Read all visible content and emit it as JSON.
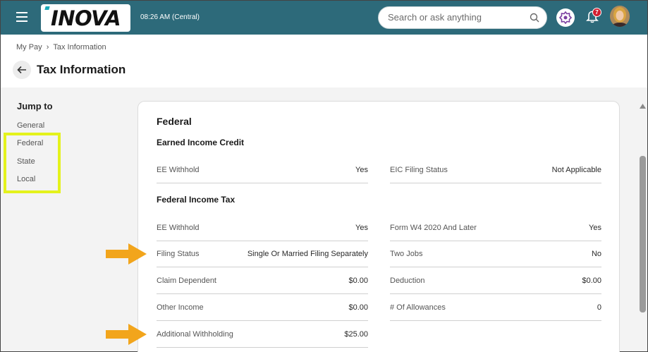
{
  "header": {
    "time": "08:26 AM (Central)",
    "logo_text": "INOVA",
    "search_placeholder": "Search or ask anything",
    "notification_count": "7",
    "brand_color": "#2d6a7a"
  },
  "breadcrumb": {
    "parent": "My Pay",
    "current": "Tax Information"
  },
  "page_title": "Tax Information",
  "jump_to": {
    "title": "Jump to",
    "items": [
      "General",
      "Federal",
      "State",
      "Local"
    ]
  },
  "federal": {
    "title": "Federal",
    "eic": {
      "title": "Earned Income Credit",
      "left": [
        {
          "label": "EE Withhold",
          "value": "Yes"
        }
      ],
      "right": [
        {
          "label": "EIC Filing Status",
          "value": "Not Applicable"
        }
      ]
    },
    "fit": {
      "title": "Federal Income Tax",
      "left": [
        {
          "label": "EE Withhold",
          "value": "Yes"
        },
        {
          "label": "Filing Status",
          "value": "Single Or Married Filing Separately"
        },
        {
          "label": "Claim Dependent",
          "value": "$0.00"
        },
        {
          "label": "Other Income",
          "value": "$0.00"
        },
        {
          "label": "Additional Withholding",
          "value": "$25.00"
        }
      ],
      "right": [
        {
          "label": "Form W4 2020 And Later",
          "value": "Yes"
        },
        {
          "label": "Two Jobs",
          "value": "No"
        },
        {
          "label": "Deduction",
          "value": "$0.00"
        },
        {
          "label": "# Of Allowances",
          "value": "0"
        }
      ]
    }
  },
  "annotation_colors": {
    "highlight": "#e4f21c",
    "arrow": "#f2a51c"
  }
}
